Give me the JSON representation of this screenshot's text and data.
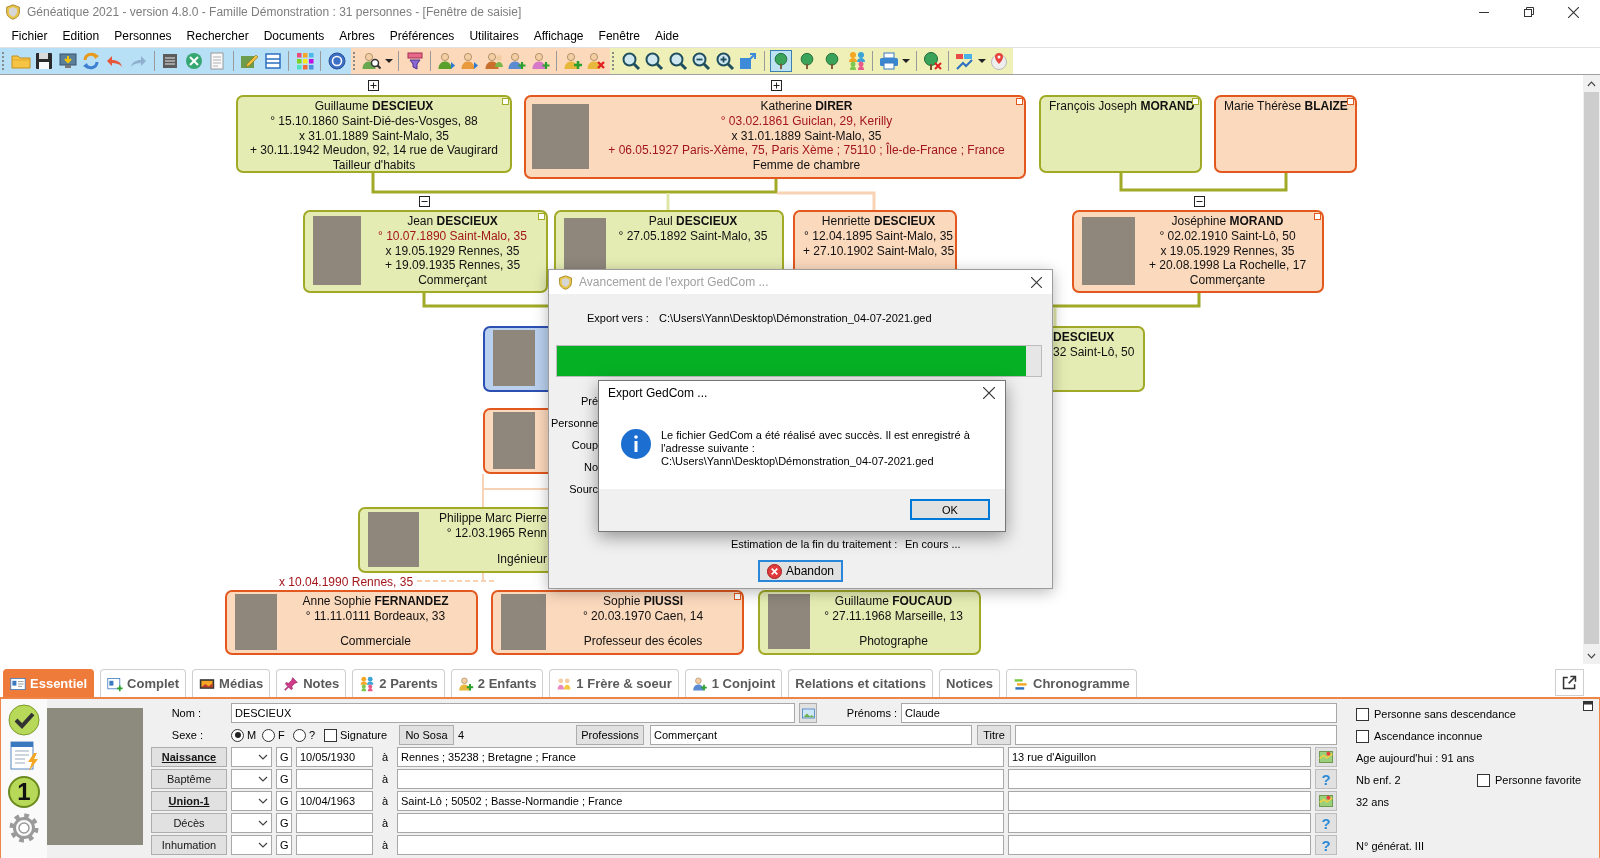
{
  "window": {
    "title": "Généatique 2021 - version 4.8.0 - Famille Démonstration : 31 personnes - [Fenêtre de saisie]"
  },
  "menu": [
    "Fichier",
    "Edition",
    "Personnes",
    "Rechercher",
    "Documents",
    "Arbres",
    "Préférences",
    "Utilitaires",
    "Affichage",
    "Fenêtre",
    "Aide"
  ],
  "toolbar": {
    "tree_views": [
      {
        "selected": true
      },
      {
        "selected": false
      },
      {
        "selected": false
      }
    ]
  },
  "tree": {
    "toggles": [
      {
        "expanded": false
      },
      {
        "expanded": false
      },
      {
        "expanded": true
      },
      {
        "expanded": true
      }
    ],
    "cards": [
      {
        "kind": "male",
        "selected": false,
        "photo": false,
        "flagged": true,
        "given": "Guillaume",
        "surname": "DESCIEUX",
        "lines": [
          {
            "text": "° 15.10.1860 Saint-Dié-des-Vosges, 88",
            "highlighted": false
          },
          {
            "text": "x 31.01.1889 Saint-Malo, 35",
            "highlighted": false
          },
          {
            "text": "+ 30.11.1942 Meudon, 92, 14 rue de Vaugirard",
            "highlighted": false
          }
        ],
        "occupation": "Tailleur d'habits"
      },
      {
        "kind": "female",
        "selected": false,
        "photo": true,
        "flagged": true,
        "given": "Katherine",
        "surname": "DIRER",
        "lines": [
          {
            "text": "° 03.02.1861 Guiclan, 29, Kerilly",
            "highlighted": true
          },
          {
            "text": "x 31.01.1889 Saint-Malo, 35",
            "highlighted": false
          },
          {
            "text": "+ 06.05.1927 Paris-Xème, 75, Paris Xème ; 75110 ; Île-de-France ; France",
            "highlighted": true
          }
        ],
        "occupation": "Femme de chambre"
      },
      {
        "kind": "male",
        "selected": false,
        "photo": false,
        "flagged": true,
        "given": "François Joseph",
        "surname": "MORAND"
      },
      {
        "kind": "female",
        "selected": false,
        "photo": false,
        "flagged": true,
        "given": "Marie Thérèse",
        "surname": "BLAIZE"
      },
      {
        "kind": "male",
        "selected": false,
        "photo": true,
        "flagged": true,
        "given": "Jean",
        "surname": "DESCIEUX",
        "lines": [
          {
            "text": "° 10.07.1890 Saint-Malo, 35",
            "highlighted": true
          },
          {
            "text": "x 19.05.1929 Rennes, 35",
            "highlighted": false
          },
          {
            "text": "+ 19.09.1935 Rennes, 35",
            "highlighted": false
          }
        ],
        "occupation": "Commerçant"
      },
      {
        "kind": "male",
        "selected": false,
        "photo": true,
        "flagged": false,
        "given": "Paul",
        "surname": "DESCIEUX",
        "lines": [
          {
            "text": "° 27.05.1892 Saint-Malo, 35",
            "highlighted": false
          }
        ]
      },
      {
        "kind": "female",
        "selected": false,
        "photo": false,
        "flagged": false,
        "given": "Henriette",
        "surname": "DESCIEUX",
        "lines": [
          {
            "text": "° 12.04.1895 Saint-Malo, 35",
            "highlighted": false
          },
          {
            "text": "+ 27.10.1902 Saint-Malo, 35",
            "highlighted": false
          }
        ]
      },
      {
        "kind": "female",
        "selected": false,
        "photo": true,
        "flagged": true,
        "given": "Joséphine",
        "surname": "MORAND",
        "lines": [
          {
            "text": "° 02.02.1910 Saint-Lô, 50",
            "highlighted": false
          },
          {
            "text": "x 19.05.1929 Rennes, 35",
            "highlighted": false
          },
          {
            "text": "+ 20.08.1998 La Rochelle, 17",
            "highlighted": false
          }
        ],
        "occupation": "Commerçante"
      },
      {
        "selected": true,
        "photo": true,
        "flagged": false
      },
      {
        "kind": "male",
        "selected": false,
        "photo": false,
        "flagged": false,
        "surname": "DESCIEUX",
        "lines": [
          {
            "text": "32 Saint-Lô, 50",
            "highlighted": false
          }
        ]
      },
      {
        "kind": "female",
        "selected": false,
        "photo": true,
        "flagged": false
      },
      {
        "kind": "male",
        "selected": false,
        "photo": true,
        "flagged": false,
        "given": "Philippe Marc Pierre",
        "lines": [
          {
            "text": "° 12.03.1965 Renn",
            "highlighted": false
          }
        ],
        "occupation": "Ingénieur"
      },
      {
        "kind": "female",
        "selected": false,
        "photo": true,
        "flagged": false,
        "given": "Anne Sophie",
        "surname": "FERNANDEZ",
        "lines": [
          {
            "text": "° 11.11.0111 Bordeaux, 33",
            "highlighted": false
          }
        ],
        "occupation": "Commerciale"
      },
      {
        "kind": "female",
        "selected": false,
        "photo": true,
        "flagged": true,
        "given": "Sophie",
        "surname": "PIUSSI",
        "lines": [
          {
            "text": "° 20.03.1970 Caen, 14",
            "highlighted": false
          }
        ],
        "occupation": "Professeur des écoles"
      },
      {
        "kind": "male",
        "selected": false,
        "photo": true,
        "flagged": false,
        "given": "Guillaume",
        "surname": "FOUCAUD",
        "lines": [
          {
            "text": "° 27.11.1968 Marseille, 13",
            "highlighted": false
          }
        ],
        "occupation": "Photographe"
      }
    ],
    "unions": [
      "x 10.04.1990 Rennes, 35"
    ]
  },
  "export_progress": {
    "title": "Avancement de l'export GedCom ...",
    "active": false,
    "destination_label": "Export vers :",
    "destination": "C:\\Users\\Yann\\Desktop\\Démonstration_04-07-2021.ged",
    "progress": {
      "level": 0.97
    },
    "labels": [
      "Pré",
      "Personne",
      "Coup",
      "No",
      "Sourc"
    ],
    "estimate_label": "Estimation de la fin du traitement :",
    "estimate_value": "En cours ...",
    "cancel_button": "Abandon"
  },
  "message_box": {
    "title": "Export GedCom ...",
    "active": true,
    "message": "Le fichier GedCom a été réalisé avec succès. Il est enregistré à\nl'adresse suivante :\nC:\\Users\\Yann\\Desktop\\Démonstration_04-07-2021.ged",
    "ok_button": "OK"
  },
  "panel": {
    "tabs": [
      {
        "label": "Essentiel",
        "selected": true
      },
      {
        "label": "Complet",
        "selected": false
      },
      {
        "label": "Médias",
        "selected": false
      },
      {
        "label": "Notes",
        "selected": false
      },
      {
        "label": "2 Parents",
        "selected": false
      },
      {
        "label": "2 Enfants",
        "selected": false
      },
      {
        "label": "1 Frère & soeur",
        "selected": false
      },
      {
        "label": "1 Conjoint",
        "selected": false
      },
      {
        "label": "Relations et citations",
        "selected": false
      },
      {
        "label": "Notices",
        "selected": false
      },
      {
        "label": "Chronogramme",
        "selected": false
      }
    ],
    "badge": "1",
    "name_label": "Nom :",
    "name_value": "DESCIEUX",
    "first_names_label": "Prénoms :",
    "first_names_value": "Claude",
    "sex_label": "Sexe :",
    "sex_options": [
      {
        "label": "M",
        "selected": true
      },
      {
        "label": "F",
        "selected": false
      },
      {
        "label": "?",
        "selected": false
      }
    ],
    "signature": {
      "label": "Signature",
      "checked": false
    },
    "sosa_button": "No Sosa",
    "sosa_value": "4",
    "professions_button": "Professions",
    "profession_value": "Commerçant",
    "title_button": "Titre",
    "events": [
      {
        "label": "Naissance",
        "filled": true,
        "calendar": "G",
        "date": "10/05/1930",
        "preposition": "à",
        "place": "Rennes ; 35238 ; Bretagne ; France",
        "address": "13 rue d'Aiguillon",
        "action": {
          "kind": "map"
        }
      },
      {
        "label": "Baptême",
        "filled": false,
        "calendar": "G",
        "preposition": "à",
        "action": {
          "kind": "help",
          "symbol": "?"
        }
      },
      {
        "label": "Union-1",
        "filled": true,
        "calendar": "G",
        "date": "10/04/1963",
        "preposition": "à",
        "place": "Saint-Lô ; 50502 ; Basse-Normandie ; France",
        "action": {
          "kind": "map"
        }
      },
      {
        "label": "Décès",
        "filled": false,
        "calendar": "G",
        "preposition": "à",
        "action": {
          "kind": "help",
          "symbol": "?"
        }
      },
      {
        "label": "Inhumation",
        "filled": false,
        "calendar": "G",
        "preposition": "à",
        "action": {
          "kind": "help",
          "symbol": "?"
        }
      }
    ],
    "options": [
      {
        "label": "Personne sans descendance",
        "checked": false
      },
      {
        "label": "Ascendance inconnue",
        "checked": false
      }
    ],
    "age": "Age aujourd'hui : 91 ans",
    "children_count": "Nb enf. 2",
    "favorite": {
      "label": "Personne favorite",
      "checked": false
    },
    "union_age": "32 ans",
    "generation": "N° générat. III"
  }
}
